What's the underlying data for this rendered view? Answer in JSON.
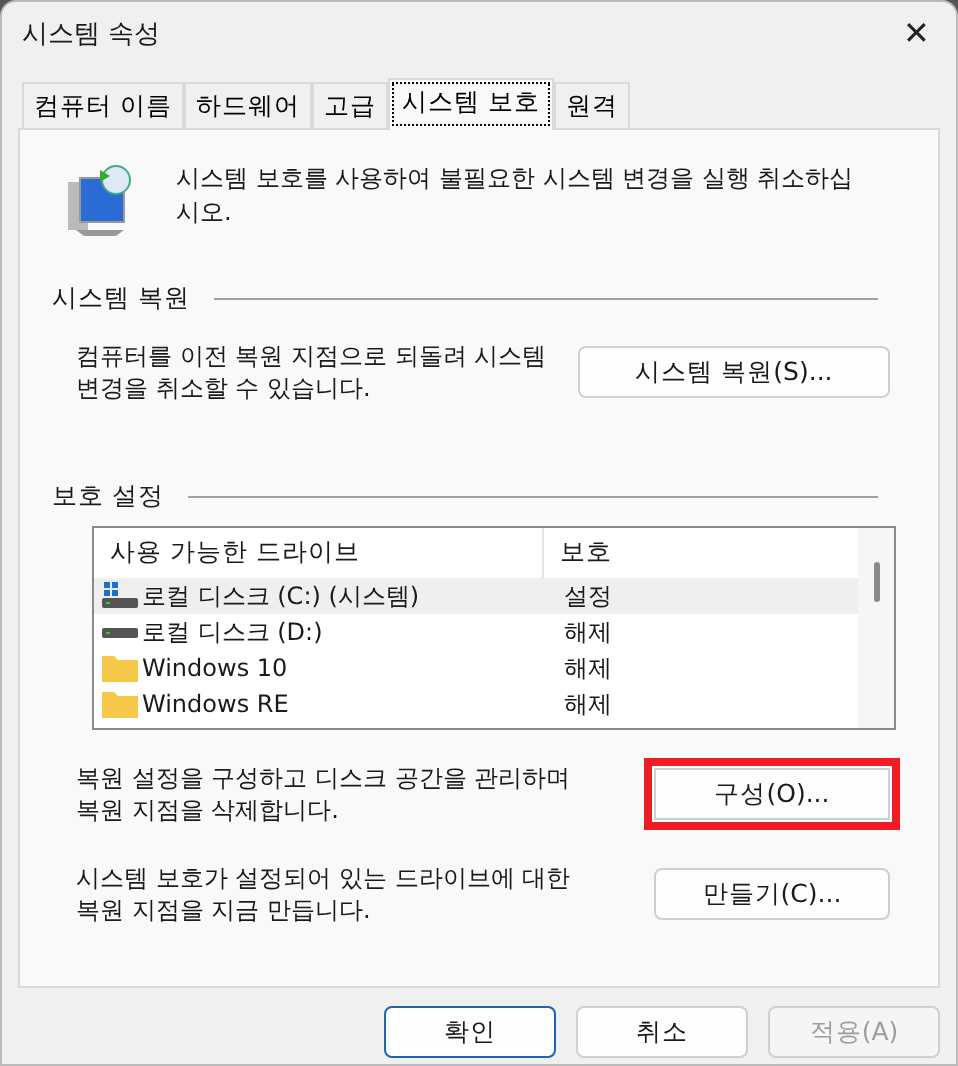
{
  "window": {
    "title": "시스템 속성",
    "close": "✕"
  },
  "tabs": [
    {
      "label": "컴퓨터 이름",
      "selected": false
    },
    {
      "label": "하드웨어",
      "selected": false
    },
    {
      "label": "고급",
      "selected": false
    },
    {
      "label": "시스템 보호",
      "selected": true
    },
    {
      "label": "원격",
      "selected": false
    }
  ],
  "intro": "시스템 보호를 사용하여 불필요한 시스템 변경을 실행 취소하십시오.",
  "restore": {
    "heading": "시스템 복원",
    "text": "컴퓨터를 이전 복원 지점으로 되돌려 시스템 변경을 취소할 수 있습니다.",
    "button": "시스템 복원(S)..."
  },
  "protection": {
    "heading": "보호 설정",
    "columns": [
      "사용 가능한 드라이브",
      "보호"
    ],
    "rows": [
      {
        "kind": "system-drive",
        "name": "로컬 디스크 (C:) (시스템)",
        "status": "설정",
        "selected": true
      },
      {
        "kind": "drive",
        "name": "로컬 디스크 (D:)",
        "status": "해제",
        "selected": false
      },
      {
        "kind": "folder",
        "name": "Windows 10",
        "status": "해제",
        "selected": false
      },
      {
        "kind": "folder",
        "name": "Windows RE",
        "status": "해제",
        "selected": false
      }
    ],
    "actions": [
      {
        "text": "복원 설정을 구성하고 디스크 공간을 관리하며 복원 지점을 삭제합니다.",
        "button": "구성(O)...",
        "highlighted": true
      },
      {
        "text": "시스템 보호가 설정되어 있는 드라이브에 대한 복원 지점을 지금 만듭니다.",
        "button": "만들기(C)...",
        "highlighted": false
      }
    ]
  },
  "buttons": [
    {
      "label": "확인",
      "default": true,
      "disabled": false
    },
    {
      "label": "취소",
      "default": false,
      "disabled": false
    },
    {
      "label": "적용(A)",
      "default": false,
      "disabled": true
    }
  ]
}
